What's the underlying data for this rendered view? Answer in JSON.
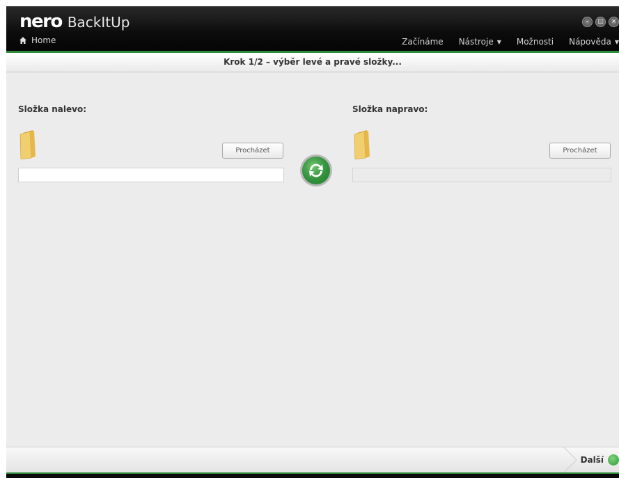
{
  "app": {
    "logo": "nero",
    "product": "BackItUp"
  },
  "nav": {
    "home": "Home",
    "menu": [
      {
        "label": "Začínáme",
        "dropdown": false
      },
      {
        "label": "Nástroje",
        "dropdown": true
      },
      {
        "label": "Možnosti",
        "dropdown": false
      },
      {
        "label": "Nápověda",
        "dropdown": true
      }
    ],
    "dropdown_arrow": "▼"
  },
  "step": {
    "title": "Krok 1/2 – výběr levé a pravé složky..."
  },
  "left": {
    "label": "Složka nalevo:",
    "browse": "Procházet",
    "path": ""
  },
  "right": {
    "label": "Složka napravo:",
    "browse": "Procházet",
    "path": ""
  },
  "footer": {
    "next": "Další"
  },
  "icons": {
    "home": "home-icon",
    "folder": "folder-icon",
    "sync": "sync-icon",
    "next": "next-arrow-icon"
  },
  "colors": {
    "accent_green": "#2f8a3c",
    "titlebar": "#0c0c0c",
    "background": "#ececec"
  }
}
